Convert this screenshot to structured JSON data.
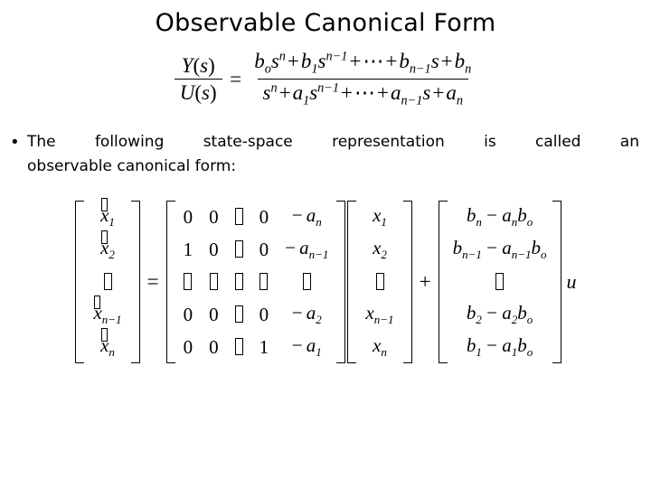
{
  "slide": {
    "title": "Observable Canonical Form",
    "background_color": "#ffffff",
    "text_color": "#000000"
  },
  "transfer_function": {
    "lhs": {
      "numerator": "Y(s)",
      "denominator": "U(s)"
    },
    "equals": "=",
    "rhs": {
      "numerator": "bₒsⁿ + b₁sⁿ⁻¹ + ⋯ + bₙ₋₁s + bₙ",
      "denominator": "sⁿ + a₁sⁿ⁻¹ + ⋯ + aₙ₋₁s + aₙ",
      "num_terms": [
        {
          "coef": "b",
          "coef_sub": "o",
          "var": "s",
          "exp": "n"
        },
        {
          "op": "+"
        },
        {
          "coef": "b",
          "coef_sub": "1",
          "var": "s",
          "exp": "n−1"
        },
        {
          "op": "+"
        },
        {
          "dots": "⋯"
        },
        {
          "op": "+"
        },
        {
          "coef": "b",
          "coef_sub": "n−1",
          "var": "s",
          "exp": ""
        },
        {
          "op": "+"
        },
        {
          "coef": "b",
          "coef_sub": "n",
          "var": "",
          "exp": ""
        }
      ],
      "den_terms": [
        {
          "coef": "",
          "coef_sub": "",
          "var": "s",
          "exp": "n"
        },
        {
          "op": "+"
        },
        {
          "coef": "a",
          "coef_sub": "1",
          "var": "s",
          "exp": "n−1"
        },
        {
          "op": "+"
        },
        {
          "dots": "⋯"
        },
        {
          "op": "+"
        },
        {
          "coef": "a",
          "coef_sub": "n−1",
          "var": "s",
          "exp": ""
        },
        {
          "op": "+"
        },
        {
          "coef": "a",
          "coef_sub": "n",
          "var": "",
          "exp": ""
        }
      ]
    }
  },
  "bullet": {
    "marker": "•",
    "line1": "The following state-space representation is called an",
    "line2": "observable canonical form:",
    "full_text": "The following state-space representation is called an observable canonical form:"
  },
  "matrix_equation": {
    "xdot_vector": {
      "base": "x",
      "accent": "dot",
      "rows": [
        "1",
        "2",
        "⋮",
        "n−1",
        "n"
      ]
    },
    "equals": "=",
    "a_matrix": {
      "rows": [
        [
          "0",
          "0",
          "⋯",
          "0",
          "−aₙ"
        ],
        [
          "1",
          "0",
          "⋯",
          "0",
          "−aₙ₋₁"
        ],
        [
          "⋮",
          "⋮",
          "⋱",
          "⋮",
          "⋮"
        ],
        [
          "0",
          "0",
          "⋯",
          "0",
          "−a₂"
        ],
        [
          "0",
          "0",
          "⋯",
          "1",
          "−a₁"
        ]
      ],
      "last_col_labels": [
        "n",
        "n−1",
        "⋮",
        "2",
        "1"
      ]
    },
    "x_vector": {
      "base": "x",
      "rows": [
        "1",
        "2",
        "⋮",
        "n−1",
        "n"
      ]
    },
    "plus": "+",
    "b_vector": {
      "rows": [
        {
          "b_sub": "n",
          "a_sub": "n",
          "b0_sub": "o",
          "text": "bₙ − aₙbₒ"
        },
        {
          "b_sub": "n−1",
          "a_sub": "n−1",
          "b0_sub": "o",
          "text": "bₙ₋₁ − aₙ₋₁bₒ"
        },
        {
          "b_sub": "",
          "a_sub": "",
          "b0_sub": "",
          "text": "⋮"
        },
        {
          "b_sub": "2",
          "a_sub": "2",
          "b0_sub": "o",
          "text": "b₂ − a₂bₒ"
        },
        {
          "b_sub": "1",
          "a_sub": "1",
          "b0_sub": "o",
          "text": "b₁ − a₁bₒ"
        }
      ]
    },
    "input_variable": "u",
    "note": "ellipsis and vertical-dot glyphs render as missing-glyph boxes"
  }
}
